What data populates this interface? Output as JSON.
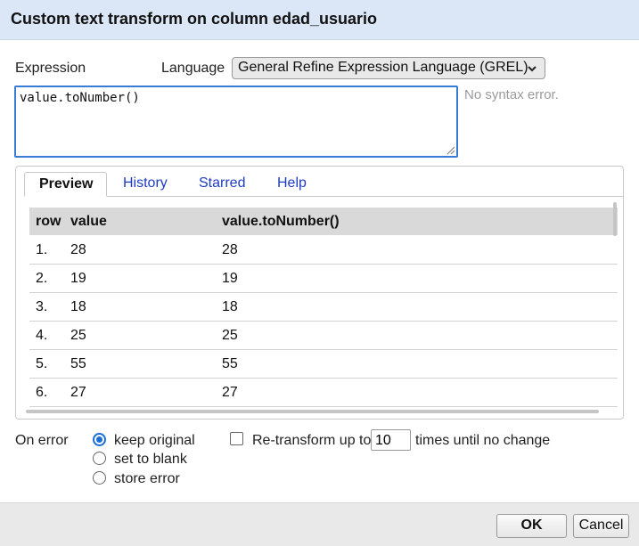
{
  "dialog": {
    "title": "Custom text transform on column edad_usuario"
  },
  "expression": {
    "label": "Expression",
    "value": "value.toNumber()",
    "status": "No syntax error."
  },
  "language": {
    "label": "Language",
    "selected": "General Refine Expression Language (GREL)"
  },
  "tabs": [
    {
      "label": "Preview",
      "active": true
    },
    {
      "label": "History",
      "active": false
    },
    {
      "label": "Starred",
      "active": false
    },
    {
      "label": "Help",
      "active": false
    }
  ],
  "preview": {
    "headers": [
      "row",
      "value",
      "value.toNumber()"
    ],
    "rows": [
      {
        "row": "1.",
        "value": "28",
        "result": "28"
      },
      {
        "row": "2.",
        "value": "19",
        "result": "19"
      },
      {
        "row": "3.",
        "value": "18",
        "result": "18"
      },
      {
        "row": "4.",
        "value": "25",
        "result": "25"
      },
      {
        "row": "5.",
        "value": "55",
        "result": "55"
      },
      {
        "row": "6.",
        "value": "27",
        "result": "27"
      }
    ]
  },
  "on_error": {
    "label": "On error",
    "options": [
      {
        "label": "keep original",
        "selected": true
      },
      {
        "label": "set to blank",
        "selected": false
      },
      {
        "label": "store error",
        "selected": false
      }
    ]
  },
  "retransform": {
    "checked": false,
    "prefix": "Re-transform up to",
    "count": "10",
    "suffix": "times until no change"
  },
  "buttons": {
    "ok": "OK",
    "cancel": "Cancel"
  },
  "colors": {
    "titlebar": "#dbe7f7",
    "accent": "#1a6ed8",
    "link": "#1f3cc4"
  }
}
